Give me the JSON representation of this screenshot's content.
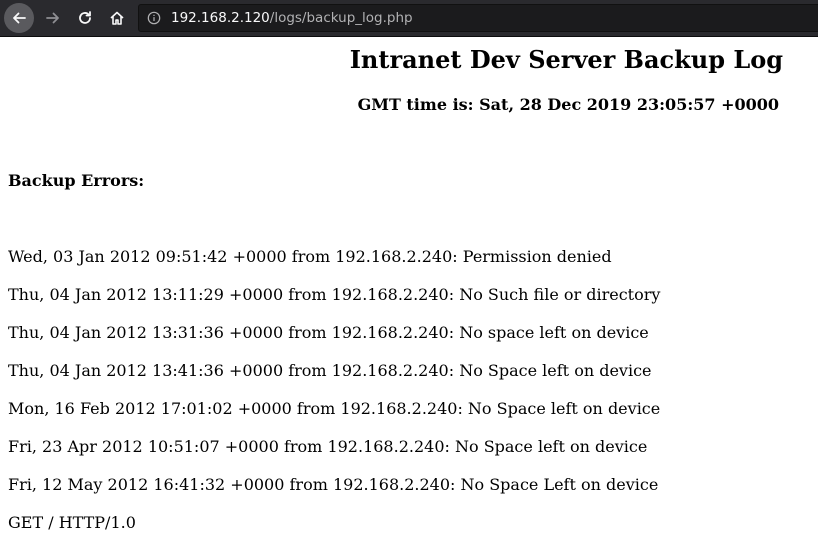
{
  "browser": {
    "url_host": "192.168.2.120",
    "url_path": "/logs/backup_log.php"
  },
  "page": {
    "title": "Intranet Dev Server Backup Log",
    "gmt_time": "GMT time is: Sat, 28 Dec 2019 23:05:57 +0000",
    "errors_heading": "Backup Errors:",
    "log_lines": [
      "Wed, 03 Jan 2012 09:51:42 +0000 from 192.168.2.240: Permission denied",
      "Thu, 04 Jan 2012 13:11:29 +0000 from 192.168.2.240: No Such file or directory",
      "Thu, 04 Jan 2012 13:31:36 +0000 from 192.168.2.240: No space left on device",
      "Thu, 04 Jan 2012 13:41:36 +0000 from 192.168.2.240: No Space left on device",
      "Mon, 16 Feb 2012 17:01:02 +0000 from 192.168.2.240: No Space left on device",
      "Fri, 23 Apr 2012 10:51:07 +0000 from 192.168.2.240: No Space left on device",
      "Fri, 12 May 2012 16:41:32 +0000 from 192.168.2.240: No Space Left on device",
      "GET / HTTP/1.0"
    ]
  }
}
